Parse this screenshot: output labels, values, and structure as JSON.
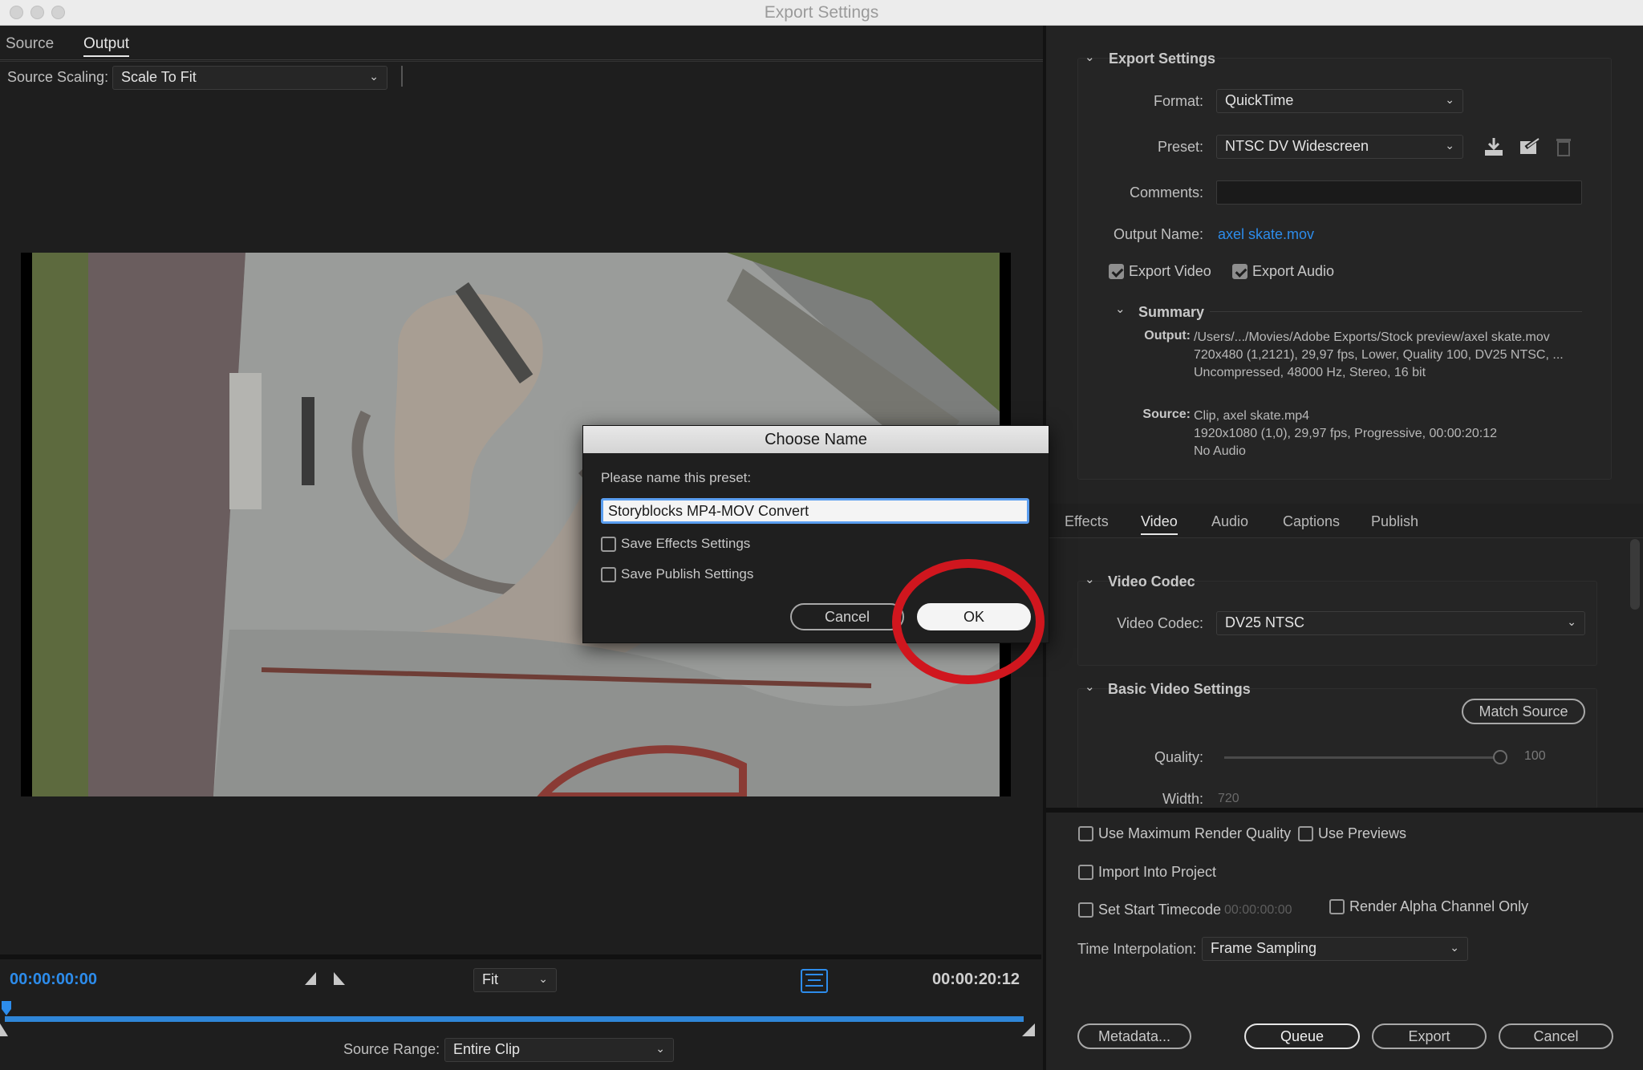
{
  "window": {
    "title": "Export Settings"
  },
  "left": {
    "tabs": [
      {
        "label": "Source"
      },
      {
        "label": "Output"
      }
    ],
    "source_scaling_label": "Source Scaling:",
    "source_scaling_value": "Scale To Fit",
    "time_current": "00:00:00:00",
    "time_total": "00:00:20:12",
    "zoom_value": "Fit",
    "source_range_label": "Source Range:",
    "source_range_value": "Entire Clip"
  },
  "export_settings": {
    "section_title": "Export Settings",
    "format_label": "Format:",
    "format_value": "QuickTime",
    "preset_label": "Preset:",
    "preset_value": "NTSC DV Widescreen",
    "comments_label": "Comments:",
    "comments_value": "",
    "output_name_label": "Output Name:",
    "output_name_value": "axel skate.mov",
    "export_video_label": "Export Video",
    "export_audio_label": "Export Audio",
    "export_video_checked": true,
    "export_audio_checked": true,
    "summary_title": "Summary",
    "output_key": "Output:",
    "output_lines": [
      "/Users/.../Movies/Adobe Exports/Stock preview/axel skate.mov",
      "720x480 (1,2121), 29,97 fps, Lower, Quality 100, DV25 NTSC, ...",
      "Uncompressed, 48000 Hz, Stereo, 16 bit"
    ],
    "source_key": "Source:",
    "source_lines": [
      "Clip, axel skate.mp4",
      "1920x1080 (1,0), 29,97 fps, Progressive, 00:00:20:12",
      "No Audio"
    ]
  },
  "tabs": [
    {
      "label": "Effects"
    },
    {
      "label": "Video"
    },
    {
      "label": "Audio"
    },
    {
      "label": "Captions"
    },
    {
      "label": "Publish"
    }
  ],
  "video": {
    "codec_section_title": "Video Codec",
    "codec_label": "Video Codec:",
    "codec_value": "DV25 NTSC",
    "basic_section_title": "Basic Video Settings",
    "match_source_label": "Match Source",
    "quality_label": "Quality:",
    "quality_value": "100",
    "width_label": "Width:",
    "width_value": "720"
  },
  "bottom": {
    "max_render_label": "Use Maximum Render Quality",
    "use_previews_label": "Use Previews",
    "import_label": "Import Into Project",
    "start_tc_label": "Set Start Timecode",
    "start_tc_value": "00:00:00:00",
    "alpha_label": "Render Alpha Channel Only",
    "time_interp_label": "Time Interpolation:",
    "time_interp_value": "Frame Sampling",
    "metadata_label": "Metadata...",
    "queue_label": "Queue",
    "export_label": "Export",
    "cancel_label": "Cancel"
  },
  "dialog": {
    "title": "Choose Name",
    "prompt": "Please name this preset:",
    "input_value": "Storyblocks MP4-MOV Convert",
    "save_effects_label": "Save Effects Settings",
    "save_publish_label": "Save Publish Settings",
    "cancel_label": "Cancel",
    "ok_label": "OK"
  },
  "colors": {
    "accent_blue": "#2d8ceb",
    "annotation_red": "#d0161e",
    "panel_bg": "#232323"
  }
}
